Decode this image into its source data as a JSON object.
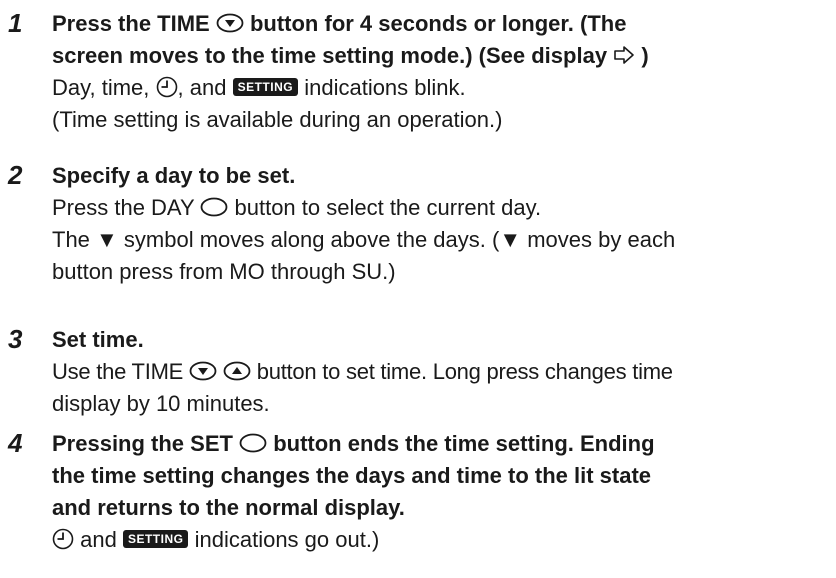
{
  "steps": [
    {
      "number": "1",
      "heading": {
        "line1_a": "Press the TIME",
        "line1_b": "button for 4 seconds or longer. (The",
        "line2_a": "screen moves to the time setting mode.) (See display",
        "line2_b": ")"
      },
      "body": {
        "line1_a": "Day, time,",
        "line1_b": ", and",
        "line1_c": "indications blink.",
        "line2": "(Time setting is available during an operation.)"
      }
    },
    {
      "number": "2",
      "heading": "Specify a day to be set.",
      "body": {
        "line1_a": "Press the DAY",
        "line1_b": "button to select the current day.",
        "line2": "The ▼ symbol moves along above the days. (▼ moves by each",
        "line3": "button press from MO through SU.)"
      }
    },
    {
      "number": "3",
      "heading": "Set time.",
      "body": {
        "line1_a": "Use the TIME",
        "line1_b": "button to set time. Long press changes time",
        "line2": "display by 10 minutes."
      }
    },
    {
      "number": "4",
      "heading": {
        "line1_a": "Pressing the SET",
        "line1_b": "button ends the time setting. Ending",
        "line2": "the time setting changes the days and time to the lit state",
        "line3": "and returns to the normal display."
      },
      "body": {
        "line1_a": "and",
        "line1_b": "indications go out.)"
      }
    }
  ],
  "badge_text": "SETTING",
  "icons": {
    "down": "down-arrow-button-icon",
    "up": "up-arrow-button-icon",
    "blank": "blank-oval-button-icon",
    "clock": "clock-icon",
    "display_pointer": "outline-arrow-right-icon"
  },
  "colors": {
    "text": "#1a1a1a",
    "badge_bg": "#1a1a1a",
    "badge_text": "#ffffff"
  }
}
